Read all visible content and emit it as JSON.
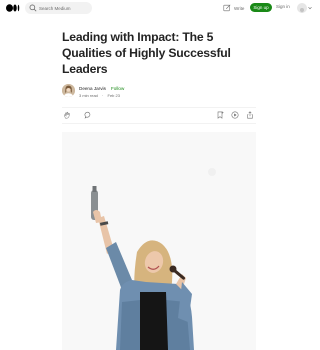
{
  "header": {
    "logo_icon": "medium-logo-icon",
    "search_placeholder": "Search Medium",
    "write_label": "Write",
    "signup_label": "Sign up",
    "signin_label": "Sign in",
    "accent_color": "#1a8917"
  },
  "article": {
    "title": "Leading with Impact: The 5 Qualities of Highly Successful Leaders",
    "author": "Deena Jarvis",
    "separator": "·",
    "follow_label": "Follow",
    "read_time": "3 min read",
    "meta_separator": "·",
    "date": "Feb 23"
  },
  "actions": {
    "left": [
      "clap-icon",
      "comment-icon"
    ],
    "right": [
      "bookmark-icon",
      "listen-icon",
      "share-icon"
    ]
  },
  "hero_image": {
    "icon": "hero-photo"
  }
}
